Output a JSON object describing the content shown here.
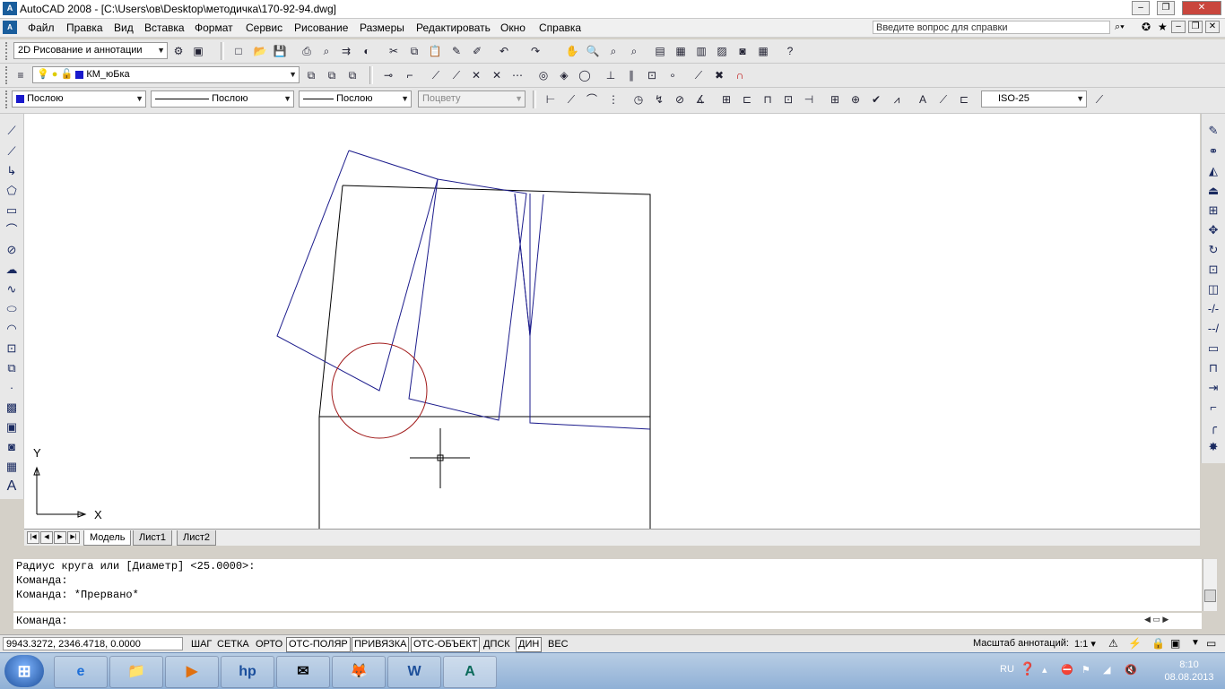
{
  "window": {
    "title": "AutoCAD 2008 - [C:\\Users\\ов\\Desktop\\методичка\\170-92-94.dwg]",
    "logo_text": "A",
    "controls": [
      "–",
      "❐",
      "✕"
    ]
  },
  "menu": {
    "items": [
      "Файл",
      "Правка",
      "Вид",
      "Вставка",
      "Формат",
      "Сервис",
      "Рисование",
      "Размеры",
      "Редактировать",
      "Окно",
      "Справка"
    ],
    "help_placeholder": "Введите вопрос для справки",
    "doc_controls": [
      "–",
      "❐",
      "✕"
    ]
  },
  "toolbar1": {
    "workspace": "2D Рисование и аннотации"
  },
  "toolbar2": {
    "layer": "КМ_юБка"
  },
  "toolbar3": {
    "color": "Послою",
    "linetype": "Послою",
    "lineweight": "Послою",
    "plotstyle": "Поцвету",
    "dimstyle": "ISO-25"
  },
  "drawing": {
    "ucs_y": "Y",
    "ucs_x": "X"
  },
  "tabs": [
    "Модель",
    "Лист1",
    "Лист2"
  ],
  "command": {
    "history": [
      "Радиус круга или [Диаметр] <25.0000>:",
      "Команда:",
      "Команда: *Прервано*"
    ],
    "prompt": "Команда:"
  },
  "status": {
    "coords": "9943.3272, 2346.4718, 0.0000",
    "buttons": [
      "ШАГ",
      "СЕТКА",
      "ОРТО",
      "ОТС-ПОЛЯР",
      "ПРИВЯЗКА",
      "ОТС-ОБЪЕКТ",
      "ДПСК",
      "ДИН",
      "ВЕС"
    ],
    "annotation_label": "Масштаб аннотаций:",
    "annotation_scale": "1:1"
  },
  "taskbar": {
    "language": "RU",
    "time": "8:10",
    "date": "08.08.2013",
    "apps": [
      "e",
      "📁",
      "▶",
      "hp",
      "✉",
      "🦊",
      "W",
      "A"
    ]
  },
  "colors": {
    "drawing_lines": "#1c1c8c",
    "circle": "#a01818",
    "black_lines": "#000000"
  }
}
